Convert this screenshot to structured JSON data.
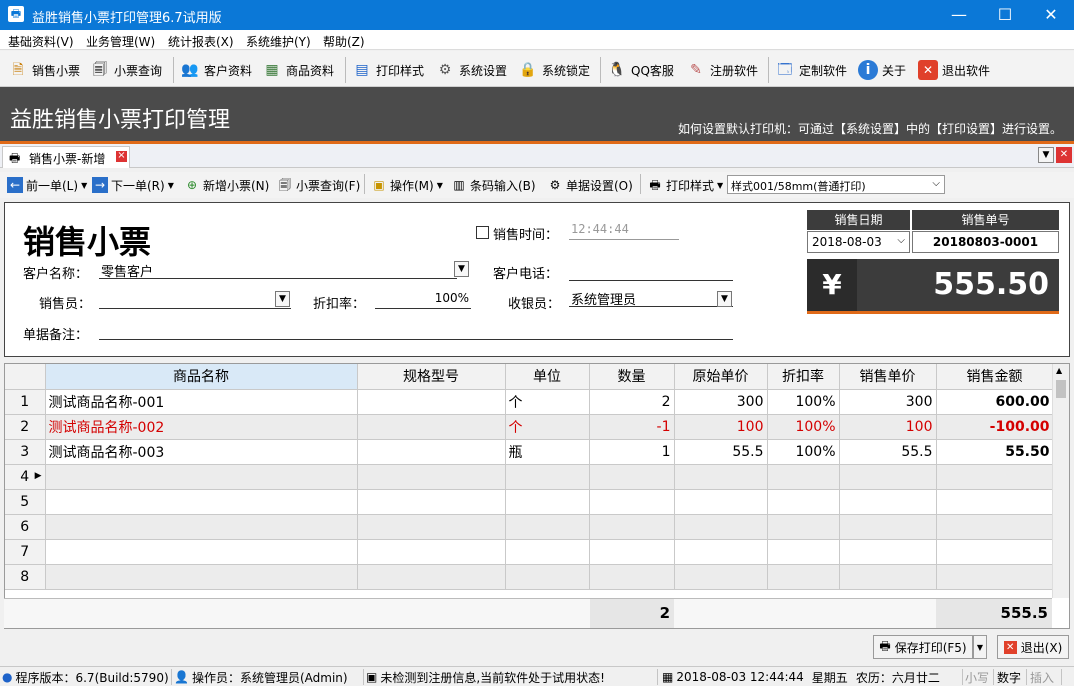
{
  "window": {
    "title": "益胜销售小票打印管理6.7试用版",
    "min": "—",
    "max": "☐",
    "close": "✕"
  },
  "menu": [
    "基础资料(V)",
    "业务管理(W)",
    "统计报表(X)",
    "系统维护(Y)",
    "帮助(Z)"
  ],
  "toolbar": {
    "sale_ticket": "销售小票",
    "ticket_query": "小票查询",
    "customers": "客户资料",
    "products": "商品资料",
    "print_style": "打印样式",
    "settings": "系统设置",
    "lock": "系统锁定",
    "qq": "QQ客服",
    "register": "注册软件",
    "custom": "定制软件",
    "about": "关于",
    "exit": "退出软件"
  },
  "banner": {
    "title": "益胜销售小票打印管理",
    "hint": "如何设置默认打印机：可通过【系统设置】中的【打印设置】进行设置。"
  },
  "tab": {
    "label": "销售小票-新增",
    "close": "×"
  },
  "subtoolbar": {
    "prev": "前一单(L)",
    "next": "下一单(R)",
    "new": "新增小票(N)",
    "query": "小票查询(F)",
    "ops": "操作(M)",
    "barcode": "条码输入(B)",
    "doc_settings": "单据设置(O)",
    "print_style": "打印样式",
    "style_value": "样式001/58mm(普通打印)"
  },
  "form": {
    "title": "销售小票",
    "time_label": "销售时间：",
    "time_value": "12:44:44",
    "customer_label": "客户名称：",
    "customer_value": "零售客户",
    "phone_label": "客户电话：",
    "phone_value": "",
    "salesman_label": "销售员：",
    "salesman_value": "",
    "discount_label": "折扣率：",
    "discount_value": "100%",
    "cashier_label": "收银员：",
    "cashier_value": "系统管理员",
    "remark_label": "单据备注：",
    "remark_value": "",
    "date_label": "销售日期",
    "date_value": "2018-08-03",
    "no_label": "销售单号",
    "no_value": "20180803-0001",
    "currency": "¥",
    "amount": "555.50"
  },
  "grid": {
    "headers": [
      "商品名称",
      "规格型号",
      "单位",
      "数量",
      "原始单价",
      "折扣率",
      "销售单价",
      "销售金额"
    ],
    "rows": [
      {
        "n": "1",
        "name": "测试商品名称-001",
        "spec": "",
        "unit": "个",
        "qty": "2",
        "price": "300",
        "disc": "100%",
        "sale": "300",
        "amt": "600.00"
      },
      {
        "n": "2",
        "name": "测试商品名称-002",
        "spec": "",
        "unit": "个",
        "qty": "-1",
        "price": "100",
        "disc": "100%",
        "sale": "100",
        "amt": "-100.00"
      },
      {
        "n": "3",
        "name": "测试商品名称-003",
        "spec": "",
        "unit": "瓶",
        "qty": "1",
        "price": "55.5",
        "disc": "100%",
        "sale": "55.5",
        "amt": "55.50"
      },
      {
        "n": "4",
        "name": "",
        "spec": "",
        "unit": "",
        "qty": "",
        "price": "",
        "disc": "",
        "sale": "",
        "amt": ""
      },
      {
        "n": "5",
        "name": "",
        "spec": "",
        "unit": "",
        "qty": "",
        "price": "",
        "disc": "",
        "sale": "",
        "amt": ""
      },
      {
        "n": "6",
        "name": "",
        "spec": "",
        "unit": "",
        "qty": "",
        "price": "",
        "disc": "",
        "sale": "",
        "amt": ""
      },
      {
        "n": "7",
        "name": "",
        "spec": "",
        "unit": "",
        "qty": "",
        "price": "",
        "disc": "",
        "sale": "",
        "amt": ""
      },
      {
        "n": "8",
        "name": "",
        "spec": "",
        "unit": "",
        "qty": "",
        "price": "",
        "disc": "",
        "sale": "",
        "amt": ""
      }
    ],
    "total_qty": "2",
    "total_amt": "555.5"
  },
  "buttons": {
    "save_print": "保存打印(F5)",
    "exit": "退出(X)"
  },
  "status": {
    "version": "程序版本：6.7(Build:5790)",
    "operator": "操作员：系统管理员(Admin)",
    "notice": "未检测到注册信息,当前软件处于试用状态!",
    "datetime": "2018-08-03 12:44:44",
    "weekday": "星期五",
    "lunar": "农历：六月廿二",
    "lower": "小写",
    "num": "数字",
    "insert": "插入"
  },
  "colors": {
    "titlebar": "#0b78d7",
    "banner": "#4b4b4b",
    "accent": "#e06a18",
    "red": "#d40000"
  }
}
